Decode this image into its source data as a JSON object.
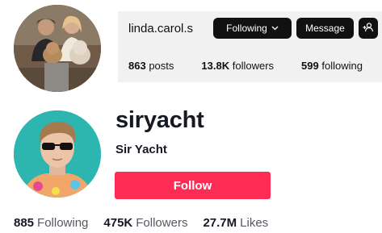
{
  "instagram": {
    "username": "linda.carol.s",
    "following_button": "Following",
    "message_button": "Message",
    "stats": [
      {
        "value": "863",
        "label": "posts"
      },
      {
        "value": "13.8K",
        "label": "followers"
      },
      {
        "value": "599",
        "label": "following"
      }
    ],
    "icons": {
      "following_chevron": "chevron-down-icon",
      "add_user": "add-user-icon"
    }
  },
  "tiktok": {
    "username": "siryacht",
    "nickname": "Sir Yacht",
    "follow_button": "Follow",
    "stats": [
      {
        "value": "885",
        "label": "Following"
      },
      {
        "value": "475K",
        "label": "Followers"
      },
      {
        "value": "27.7M",
        "label": "Likes"
      }
    ],
    "colors": {
      "follow_button": "#fe2c55",
      "avatar_bg": "#2db6b0"
    }
  }
}
